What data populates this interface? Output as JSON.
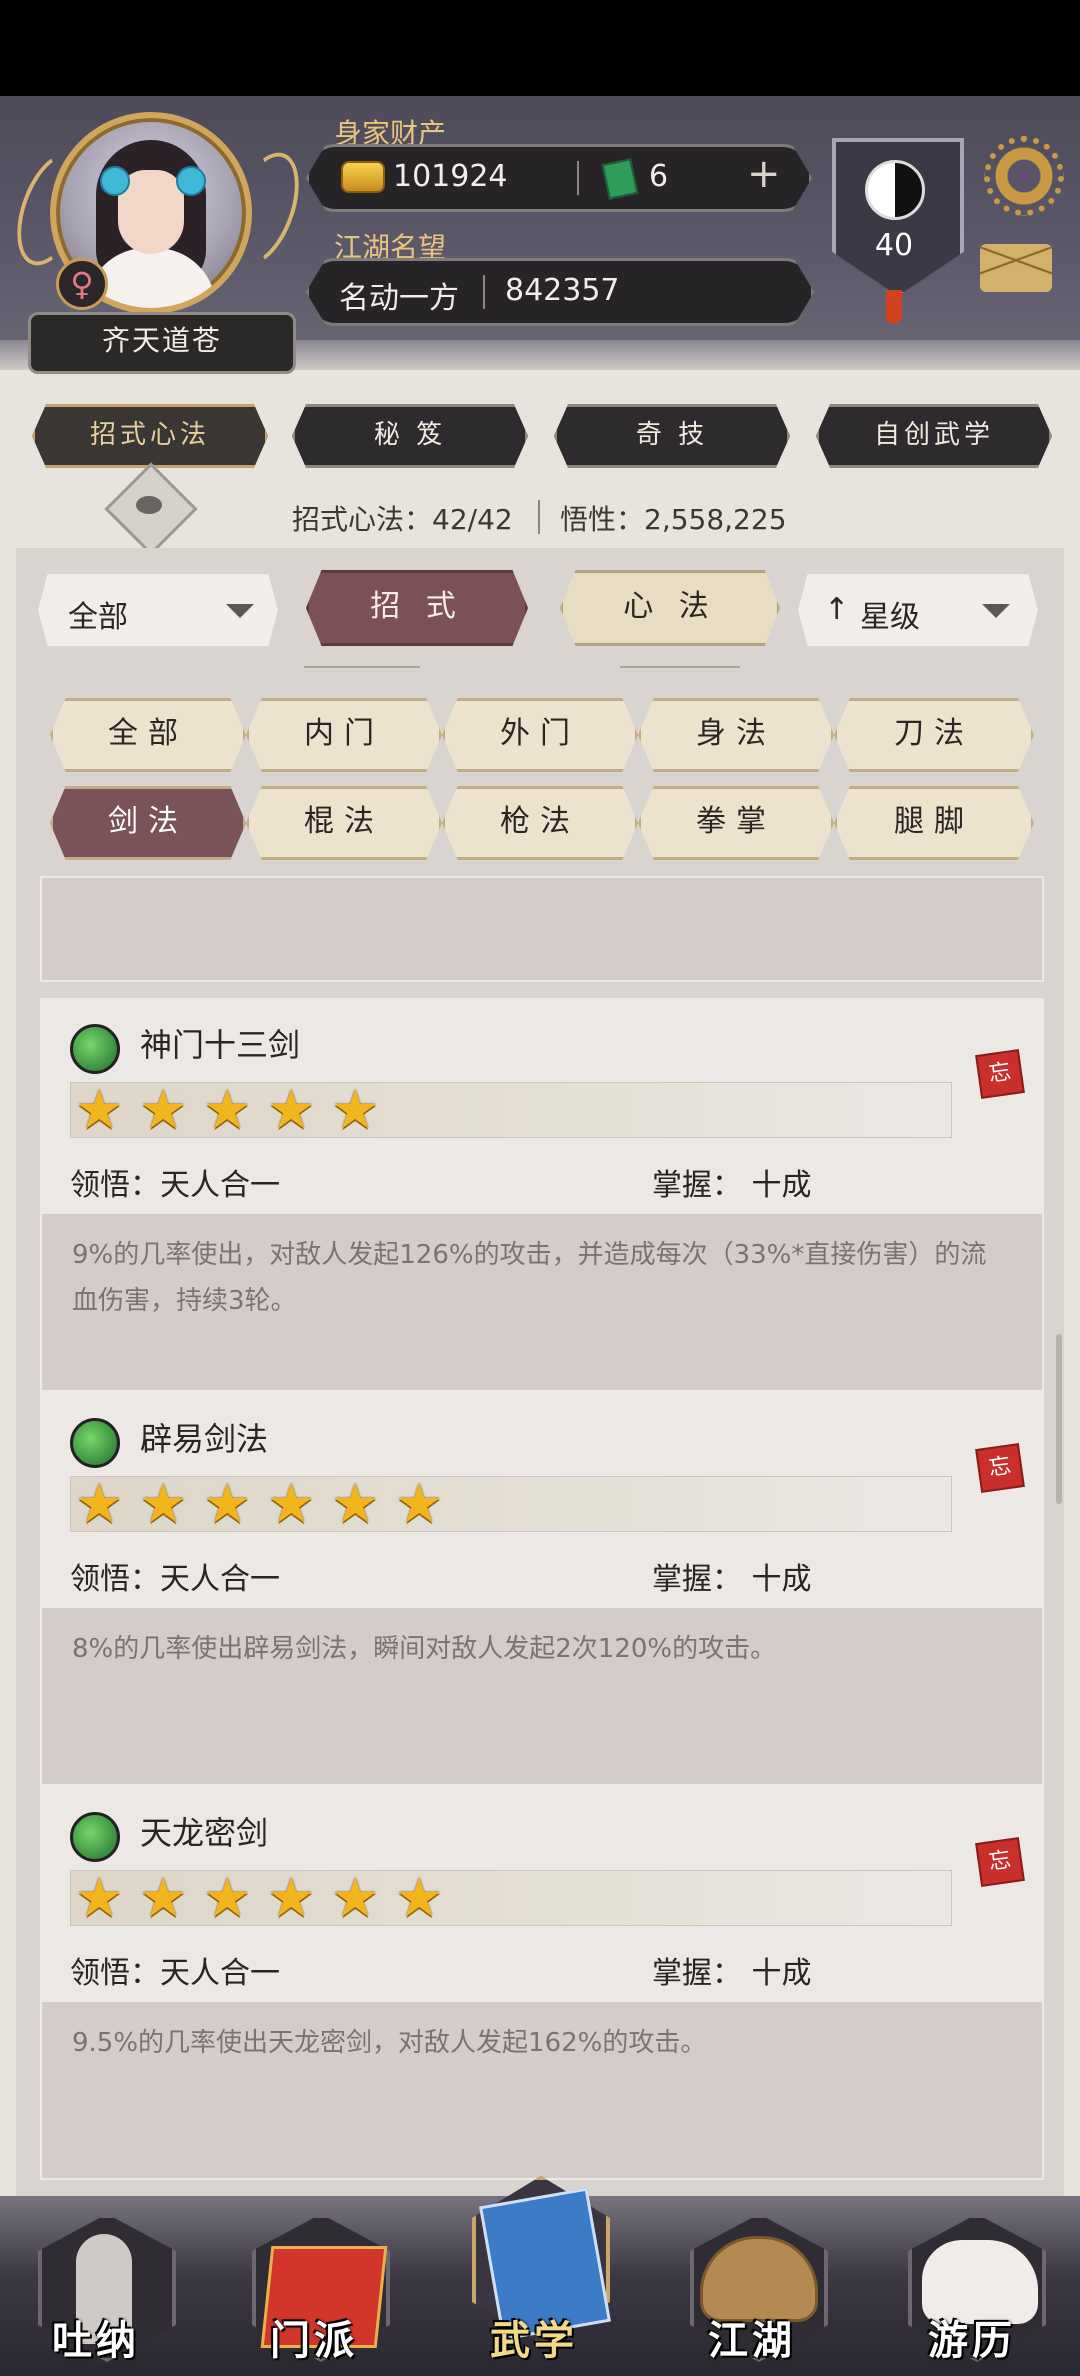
{
  "header": {
    "player_name": "齐天道苍",
    "gender_symbol": "♀",
    "wealth_label": "身家财产",
    "gold": "101924",
    "jade": "6",
    "add_symbol": "+",
    "reputation_label": "江湖名望",
    "reputation_title": "名动一方",
    "reputation_value": "842357",
    "level": "40",
    "mail_icon": "mail-icon",
    "settings_icon": "gear-icon"
  },
  "top_tabs": [
    {
      "label": "招式心法",
      "active": true
    },
    {
      "label": "秘 笈",
      "active": false
    },
    {
      "label": "奇 技",
      "active": false
    },
    {
      "label": "自创武学",
      "active": false
    }
  ],
  "stats": {
    "moves_label": "招式心法：42/42",
    "insight_label": "悟性：2,558,225"
  },
  "filters": {
    "category_select": "全部",
    "segments": [
      {
        "label": "招 式",
        "active": true
      },
      {
        "label": "心 法",
        "active": false
      }
    ],
    "sort_select": "星级",
    "sort_arrow": "↑",
    "chips_row1": [
      "全部",
      "内门",
      "外门",
      "身法",
      "刀法"
    ],
    "chips_row2": [
      "剑法",
      "棍法",
      "枪法",
      "拳掌",
      "腿脚"
    ],
    "active_chip": "剑法"
  },
  "skills": [
    {
      "name": "神门十三剑",
      "stars": 5,
      "comprehension": "领悟：天人合一",
      "mastery": "掌握：  十成",
      "description": "9%的几率使出，对敌人发起126%的攻击，并造成每次（33%*直接伤害）的流血伤害，持续3轮。",
      "forget": "忘"
    },
    {
      "name": "辟易剑法",
      "stars": 6,
      "comprehension": "领悟：天人合一",
      "mastery": "掌握：  十成",
      "description": "8%的几率使出辟易剑法，瞬间对敌人发起2次120%的攻击。",
      "forget": "忘"
    },
    {
      "name": "天龙密剑",
      "stars": 6,
      "comprehension": "领悟：天人合一",
      "mastery": "掌握：  十成",
      "description": "9.5%的几率使出天龙密剑，对敌人发起162%的攻击。",
      "forget": "忘"
    }
  ],
  "bottom_nav": [
    {
      "label": "吐纳",
      "active": false
    },
    {
      "label": "门派",
      "active": false
    },
    {
      "label": "武学",
      "active": true
    },
    {
      "label": "江湖",
      "active": false
    },
    {
      "label": "游历",
      "active": false
    }
  ],
  "colors": {
    "accent_gold": "#e8c47d",
    "active_tab": "#7b5057",
    "star": "#f2b51e"
  }
}
